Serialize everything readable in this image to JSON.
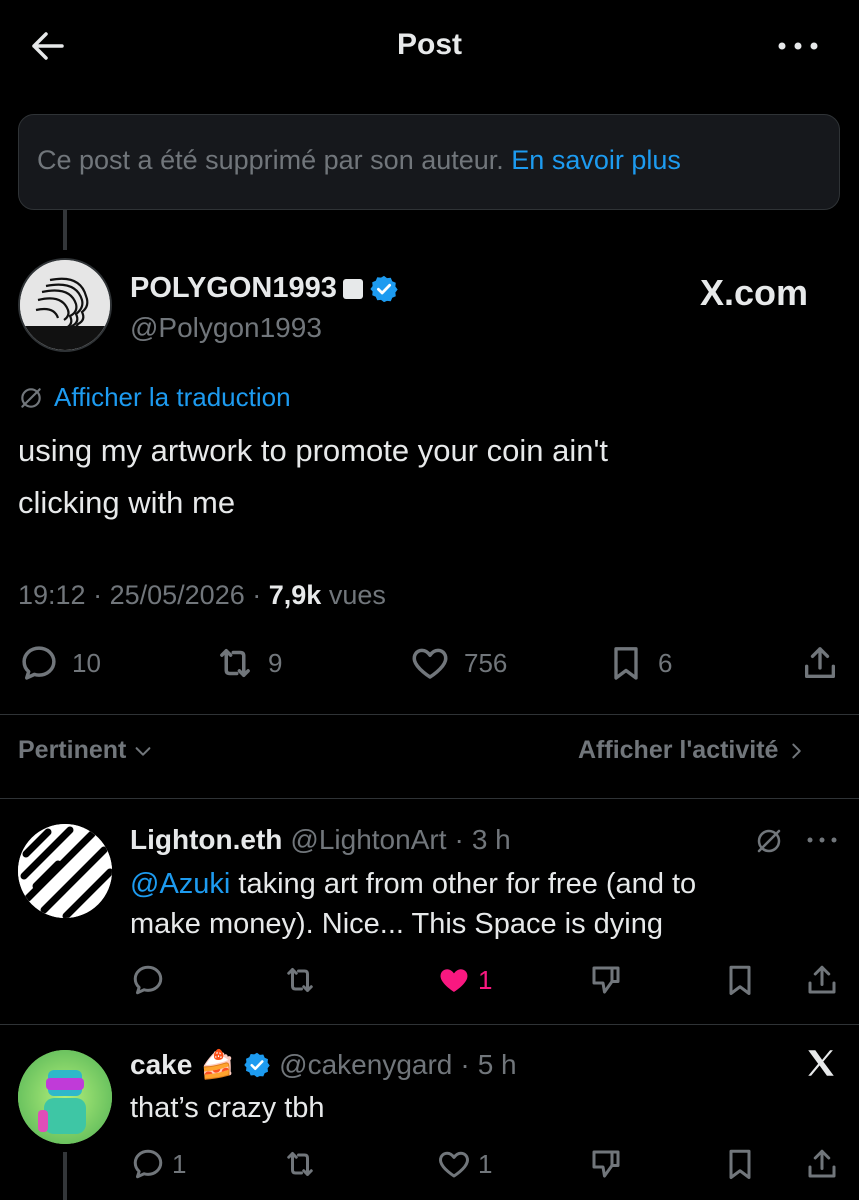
{
  "header": {
    "title": "Post"
  },
  "notice": {
    "text": "Ce post a été supprimé par son auteur.",
    "link": "En savoir plus"
  },
  "post": {
    "display_name": "POLYGON1993",
    "handle": "@Polygon1993",
    "source": "X.com",
    "translate_label": "Afficher la traduction",
    "text_line1": "using my artwork to promote your coin ain't",
    "text_line2": "clicking with me",
    "time": "19:12",
    "date": "25/05/2026",
    "views_count": "7,9k",
    "views_label": "vues",
    "stats": {
      "replies": "10",
      "reposts": "9",
      "likes": "756",
      "bookmarks": "6"
    }
  },
  "sort": {
    "left_label": "Pertinent",
    "right_label": "Afficher l'activité"
  },
  "replies": [
    {
      "name": "Lighton.eth",
      "handle": "@LightonArt",
      "time": "3 h",
      "mention": "@Azuki",
      "text_line1_rest": " taking art from other for free (and to",
      "text_line2": "make money). Nice... This Space is dying",
      "likes": "1",
      "liked": true
    },
    {
      "name": "cake",
      "emoji": "🍰",
      "handle": "@cakenygard",
      "time": "5 h",
      "text": "that’s crazy tbh",
      "replies": "1",
      "likes": "1"
    }
  ],
  "colors": {
    "background": "#000000",
    "accent": "#1d9bf0",
    "muted": "#71767b",
    "like": "#f91880",
    "verified": "#1d9bf0"
  }
}
